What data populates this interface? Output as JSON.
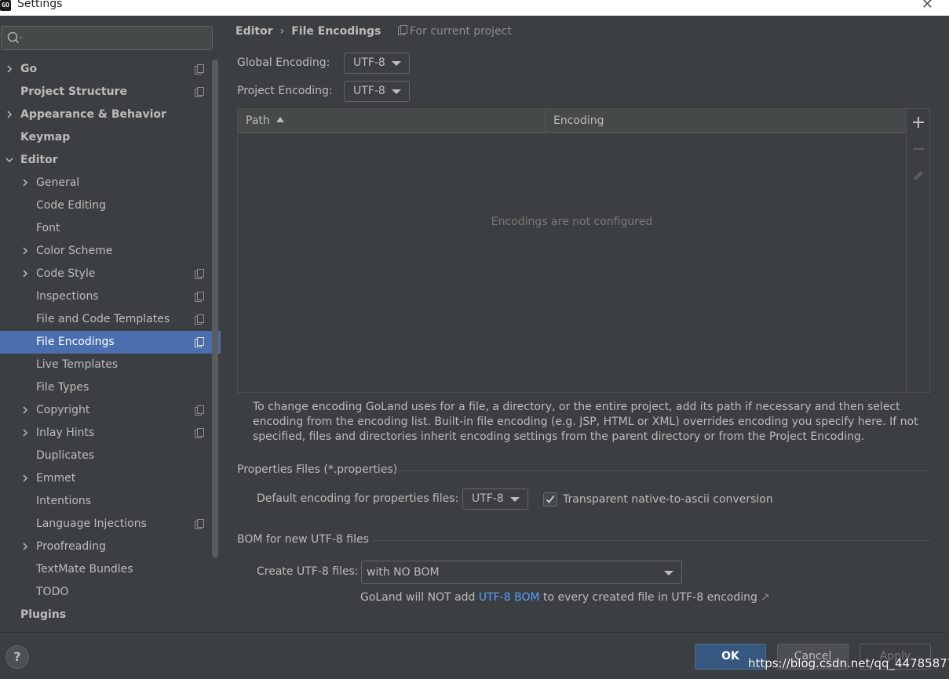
{
  "window": {
    "title": "Settings",
    "close_glyph": "✕"
  },
  "search": {
    "placeholder": ""
  },
  "sidebar": {
    "items": [
      {
        "label": "Go",
        "level": 0,
        "chevron": "right",
        "bold": true,
        "project_icon": true,
        "selected": false
      },
      {
        "label": "Project Structure",
        "level": 0,
        "chevron": "none",
        "bold": true,
        "project_icon": true,
        "selected": false
      },
      {
        "label": "Appearance & Behavior",
        "level": 0,
        "chevron": "right",
        "bold": true,
        "project_icon": false,
        "selected": false
      },
      {
        "label": "Keymap",
        "level": 0,
        "chevron": "none",
        "bold": true,
        "project_icon": false,
        "selected": false
      },
      {
        "label": "Editor",
        "level": 0,
        "chevron": "down",
        "bold": true,
        "project_icon": false,
        "selected": false
      },
      {
        "label": "General",
        "level": 1,
        "chevron": "right",
        "bold": false,
        "project_icon": false,
        "selected": false
      },
      {
        "label": "Code Editing",
        "level": 1,
        "chevron": "none",
        "bold": false,
        "project_icon": false,
        "selected": false
      },
      {
        "label": "Font",
        "level": 1,
        "chevron": "none",
        "bold": false,
        "project_icon": false,
        "selected": false
      },
      {
        "label": "Color Scheme",
        "level": 1,
        "chevron": "right",
        "bold": false,
        "project_icon": false,
        "selected": false
      },
      {
        "label": "Code Style",
        "level": 1,
        "chevron": "right",
        "bold": false,
        "project_icon": true,
        "selected": false
      },
      {
        "label": "Inspections",
        "level": 1,
        "chevron": "none",
        "bold": false,
        "project_icon": true,
        "selected": false
      },
      {
        "label": "File and Code Templates",
        "level": 1,
        "chevron": "none",
        "bold": false,
        "project_icon": true,
        "selected": false
      },
      {
        "label": "File Encodings",
        "level": 1,
        "chevron": "none",
        "bold": false,
        "project_icon": true,
        "selected": true
      },
      {
        "label": "Live Templates",
        "level": 1,
        "chevron": "none",
        "bold": false,
        "project_icon": false,
        "selected": false
      },
      {
        "label": "File Types",
        "level": 1,
        "chevron": "none",
        "bold": false,
        "project_icon": false,
        "selected": false
      },
      {
        "label": "Copyright",
        "level": 1,
        "chevron": "right",
        "bold": false,
        "project_icon": true,
        "selected": false
      },
      {
        "label": "Inlay Hints",
        "level": 1,
        "chevron": "right",
        "bold": false,
        "project_icon": true,
        "selected": false
      },
      {
        "label": "Duplicates",
        "level": 1,
        "chevron": "none",
        "bold": false,
        "project_icon": false,
        "selected": false
      },
      {
        "label": "Emmet",
        "level": 1,
        "chevron": "right",
        "bold": false,
        "project_icon": false,
        "selected": false
      },
      {
        "label": "Intentions",
        "level": 1,
        "chevron": "none",
        "bold": false,
        "project_icon": false,
        "selected": false
      },
      {
        "label": "Language Injections",
        "level": 1,
        "chevron": "none",
        "bold": false,
        "project_icon": true,
        "selected": false
      },
      {
        "label": "Proofreading",
        "level": 1,
        "chevron": "right",
        "bold": false,
        "project_icon": false,
        "selected": false
      },
      {
        "label": "TextMate Bundles",
        "level": 1,
        "chevron": "none",
        "bold": false,
        "project_icon": false,
        "selected": false
      },
      {
        "label": "TODO",
        "level": 1,
        "chevron": "none",
        "bold": false,
        "project_icon": false,
        "selected": false
      },
      {
        "label": "Plugins",
        "level": 0,
        "chevron": "none",
        "bold": true,
        "project_icon": false,
        "selected": false
      }
    ]
  },
  "breadcrumb": {
    "parent": "Editor",
    "separator": "›",
    "current": "File Encodings",
    "scope": "For current project"
  },
  "global_encoding": {
    "label": "Global Encoding:",
    "value": "UTF-8"
  },
  "project_encoding": {
    "label": "Project Encoding:",
    "value": "UTF-8"
  },
  "table": {
    "columns": [
      "Path",
      "Encoding"
    ],
    "sorted_column": "Path",
    "sort_direction": "ascending",
    "empty_text": "Encodings are not configured",
    "rows": []
  },
  "help_text": "To change encoding GoLand uses for a file, a directory, or the entire project, add its path if necessary and then select encoding from the encoding list. Built-in file encoding (e.g. JSP, HTML or XML) overrides encoding you specify here. If not specified, files and directories inherit encoding settings from the parent directory or from the Project Encoding.",
  "properties_section": {
    "title": "Properties Files (*.properties)",
    "default_label": "Default encoding for properties files:",
    "default_value": "UTF-8",
    "native_ascii_label": "Transparent native-to-ascii conversion",
    "native_ascii_checked": true
  },
  "bom_section": {
    "title": "BOM for new UTF-8 files",
    "create_label": "Create UTF-8 files:",
    "create_value": "with NO BOM",
    "note_prefix": "GoLand will NOT add",
    "note_link": "UTF-8 BOM",
    "note_suffix": "to every created file in UTF-8 encoding",
    "note_ext": "↗"
  },
  "buttons": {
    "help": "?",
    "ok": "OK",
    "cancel": "Cancel",
    "apply": "Apply"
  },
  "watermark": "https://blog.csdn.net/qq_44785877",
  "colors": {
    "background": "#3c3f41",
    "selection": "#4b6eaf",
    "ok_button": "#365880",
    "link": "#589df6",
    "text": "#bbbbbb"
  }
}
